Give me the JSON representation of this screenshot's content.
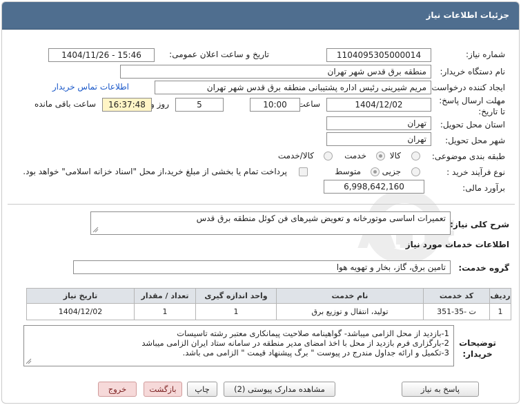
{
  "header": {
    "title": "جزئیات اطلاعات نیاز"
  },
  "form": {
    "need_number_label": "شماره نیاز:",
    "need_number": "1104095305000014",
    "announce_label": "تاریخ و ساعت اعلان عمومی:",
    "announce_value": "1404/11/26 - 15:46",
    "buyer_org_label": "نام دستگاه خریدار:",
    "buyer_org": "منطقه برق قدس شهر تهران",
    "creator_label": "ایجاد کننده درخواست:",
    "creator": "مریم شیرینی رئیس اداره پشتیبانی منطقه برق قدس شهر تهران",
    "contact_link": "اطلاعات تماس خریدار",
    "deadline_label": "مهلت ارسال پاسخ: تا تاریخ:",
    "deadline_date": "1404/12/02",
    "time_label": "ساعت",
    "deadline_time": "10:00",
    "days_value": "5",
    "days_label": "روز و",
    "remaining_time": "16:37:48",
    "remaining_label": "ساعت باقی مانده",
    "province_label": "استان محل تحویل:",
    "province": "تهران",
    "city_label": "شهر محل تحویل:",
    "city": "تهران",
    "category_label": "طبقه بندی موضوعی:",
    "category_options": [
      "کالا",
      "خدمت",
      "کالا/خدمت"
    ],
    "process_label": "نوع فرآیند خرید :",
    "process_options": [
      "جزیی",
      "متوسط"
    ],
    "payment_note": "پرداخت تمام یا بخشی از مبلغ خرید،از محل \"اسناد خزانه اسلامی\" خواهد بود.",
    "estimate_label": "برآورد مالی:",
    "estimate": "6,998,642,160"
  },
  "summary": {
    "label": "شرح کلی نیاز:",
    "text": "تعمیرات اساسی موتورخانه و تعویض شیرهای فن کوئل منطقه برق قدس"
  },
  "services": {
    "section_title": "اطلاعات خدمات مورد نیاز",
    "group_label": "گروه خدمت:",
    "group_value": "تامین برق، گاز، بخار و تهویه هوا",
    "table": {
      "headers": [
        "ردیف",
        "کد خدمت",
        "نام خدمت",
        "واحد اندازه گیری",
        "تعداد / مقدار",
        "تاریخ نیاز"
      ],
      "rows": [
        [
          "1",
          "ت -35-351",
          "تولید، انتقال و توزیع برق",
          "1",
          "1",
          "1404/12/02"
        ]
      ]
    }
  },
  "notes": {
    "label": "توضیحات خریدار:",
    "lines": [
      "1-بازدید از محل الزامی میباشد- گواهینامه صلاحیت پیمانکاری معتبر رشته تاسیسات",
      "2-بارگزاری فرم بازدید از محل با اخذ امضای مدیر منطقه در سامانه ستاد ایران الزامی میباشد",
      "3-تکمیل و ارائه  جداول مندرج در پیوست \" برگ پیشنهاد قیمت \" الزامی می باشد."
    ]
  },
  "buttons": {
    "reply": "پاسخ به نیاز",
    "view_docs": "مشاهده مدارک پیوستی (2)",
    "print": "چاپ",
    "back": "بازگشت",
    "exit": "خروج"
  },
  "colors": {
    "titlebar": "#4f6e8f",
    "highlight": "#fff5c6",
    "link": "#1a58c9"
  }
}
